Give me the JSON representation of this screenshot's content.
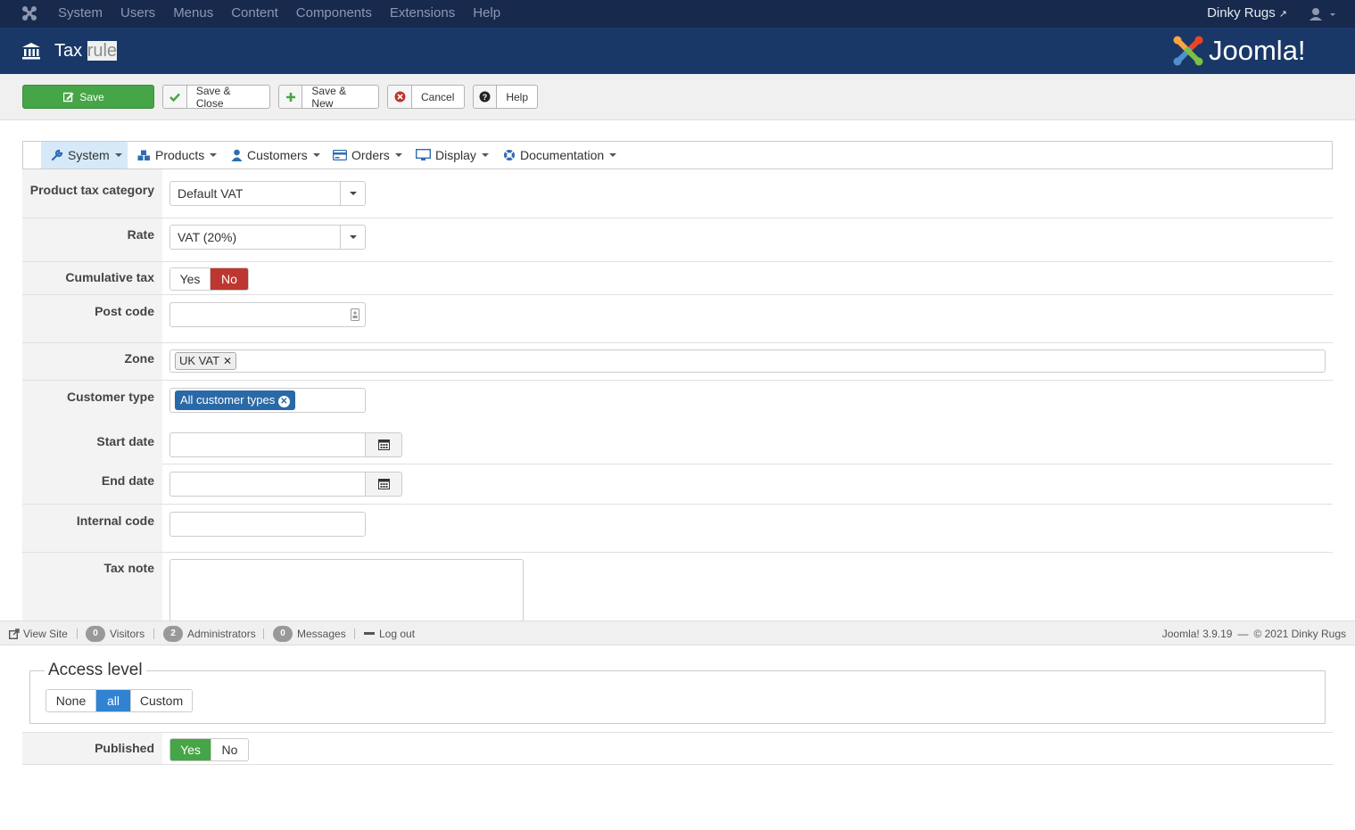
{
  "topnav": {
    "menu": [
      "System",
      "Users",
      "Menus",
      "Content",
      "Components",
      "Extensions",
      "Help"
    ],
    "site_name": "Dinky Rugs"
  },
  "header": {
    "title_main": "Tax",
    "title_highlight": "rule",
    "logo_text": "Joomla!"
  },
  "toolbar": {
    "save": "Save",
    "save_close": "Save & Close",
    "save_new": "Save & New",
    "cancel": "Cancel",
    "help": "Help"
  },
  "submenu": [
    "System",
    "Products",
    "Customers",
    "Orders",
    "Display",
    "Documentation"
  ],
  "form": {
    "product_tax_category": {
      "label": "Product tax category",
      "value": "Default VAT"
    },
    "rate": {
      "label": "Rate",
      "value": "VAT (20%)"
    },
    "cumulative_tax": {
      "label": "Cumulative tax",
      "yes": "Yes",
      "no": "No",
      "selected": "No"
    },
    "post_code": {
      "label": "Post code",
      "value": ""
    },
    "zone": {
      "label": "Zone",
      "tags": [
        "UK VAT"
      ]
    },
    "customer_type": {
      "label": "Customer type",
      "tags": [
        "All customer types"
      ]
    },
    "start_date": {
      "label": "Start date",
      "value": ""
    },
    "end_date": {
      "label": "End date",
      "value": ""
    },
    "internal_code": {
      "label": "Internal code",
      "value": ""
    },
    "tax_note": {
      "label": "Tax note",
      "value": ""
    },
    "access_level": {
      "legend": "Access level",
      "options": [
        "None",
        "all",
        "Custom"
      ],
      "selected": "all"
    },
    "published": {
      "label": "Published",
      "yes": "Yes",
      "no": "No",
      "selected": "Yes"
    }
  },
  "statusbar": {
    "view_site": "View Site",
    "visitors_count": "0",
    "visitors": "Visitors",
    "admins_count": "2",
    "admins": "Administrators",
    "messages_count": "0",
    "messages": "Messages",
    "logout": "Log out",
    "version": "Joomla! 3.9.19",
    "dash": "—",
    "copyright": "© 2021 Dinky Rugs"
  },
  "colors": {
    "navbar": "#17294d",
    "header": "#1a3867",
    "save_green": "#46a546",
    "no_red": "#bd362f",
    "tag_blue": "#2a69a7",
    "selected_blue": "#2f83d2"
  }
}
